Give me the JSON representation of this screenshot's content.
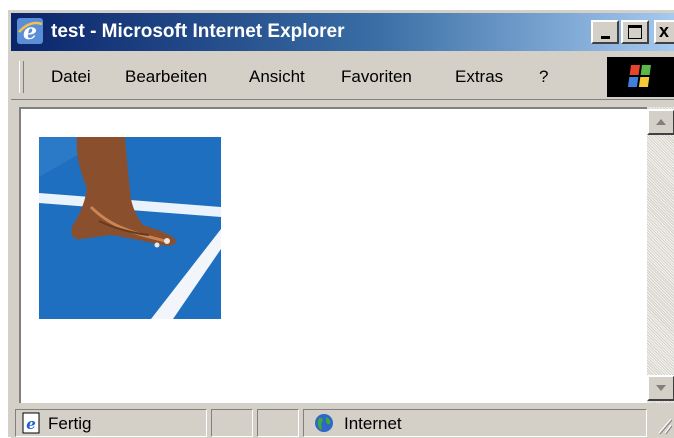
{
  "window": {
    "title": "test - Microsoft Internet Explorer",
    "minimize_icon": "minimize-icon",
    "maximize_icon": "maximize-icon",
    "close_icon": "close-icon",
    "close_label": "x"
  },
  "menubar": {
    "items": [
      {
        "label": "Datei"
      },
      {
        "label": "Bearbeiten"
      },
      {
        "label": "Ansicht"
      },
      {
        "label": "Favoriten"
      },
      {
        "label": "Extras"
      },
      {
        "label": "?"
      }
    ],
    "throbber_icon": "windows-logo-icon"
  },
  "content": {
    "image": "sprinter-hand-on-blue-track-image"
  },
  "statusbar": {
    "status_text": "Fertig",
    "zone_text": "Internet",
    "status_icon": "ie-page-icon",
    "zone_icon": "globe-icon"
  },
  "colors": {
    "title_gradient_start": "#0a246a",
    "title_gradient_end": "#a6caf0",
    "chrome": "#d4d0c8",
    "track_blue": "#1f6fc0"
  }
}
